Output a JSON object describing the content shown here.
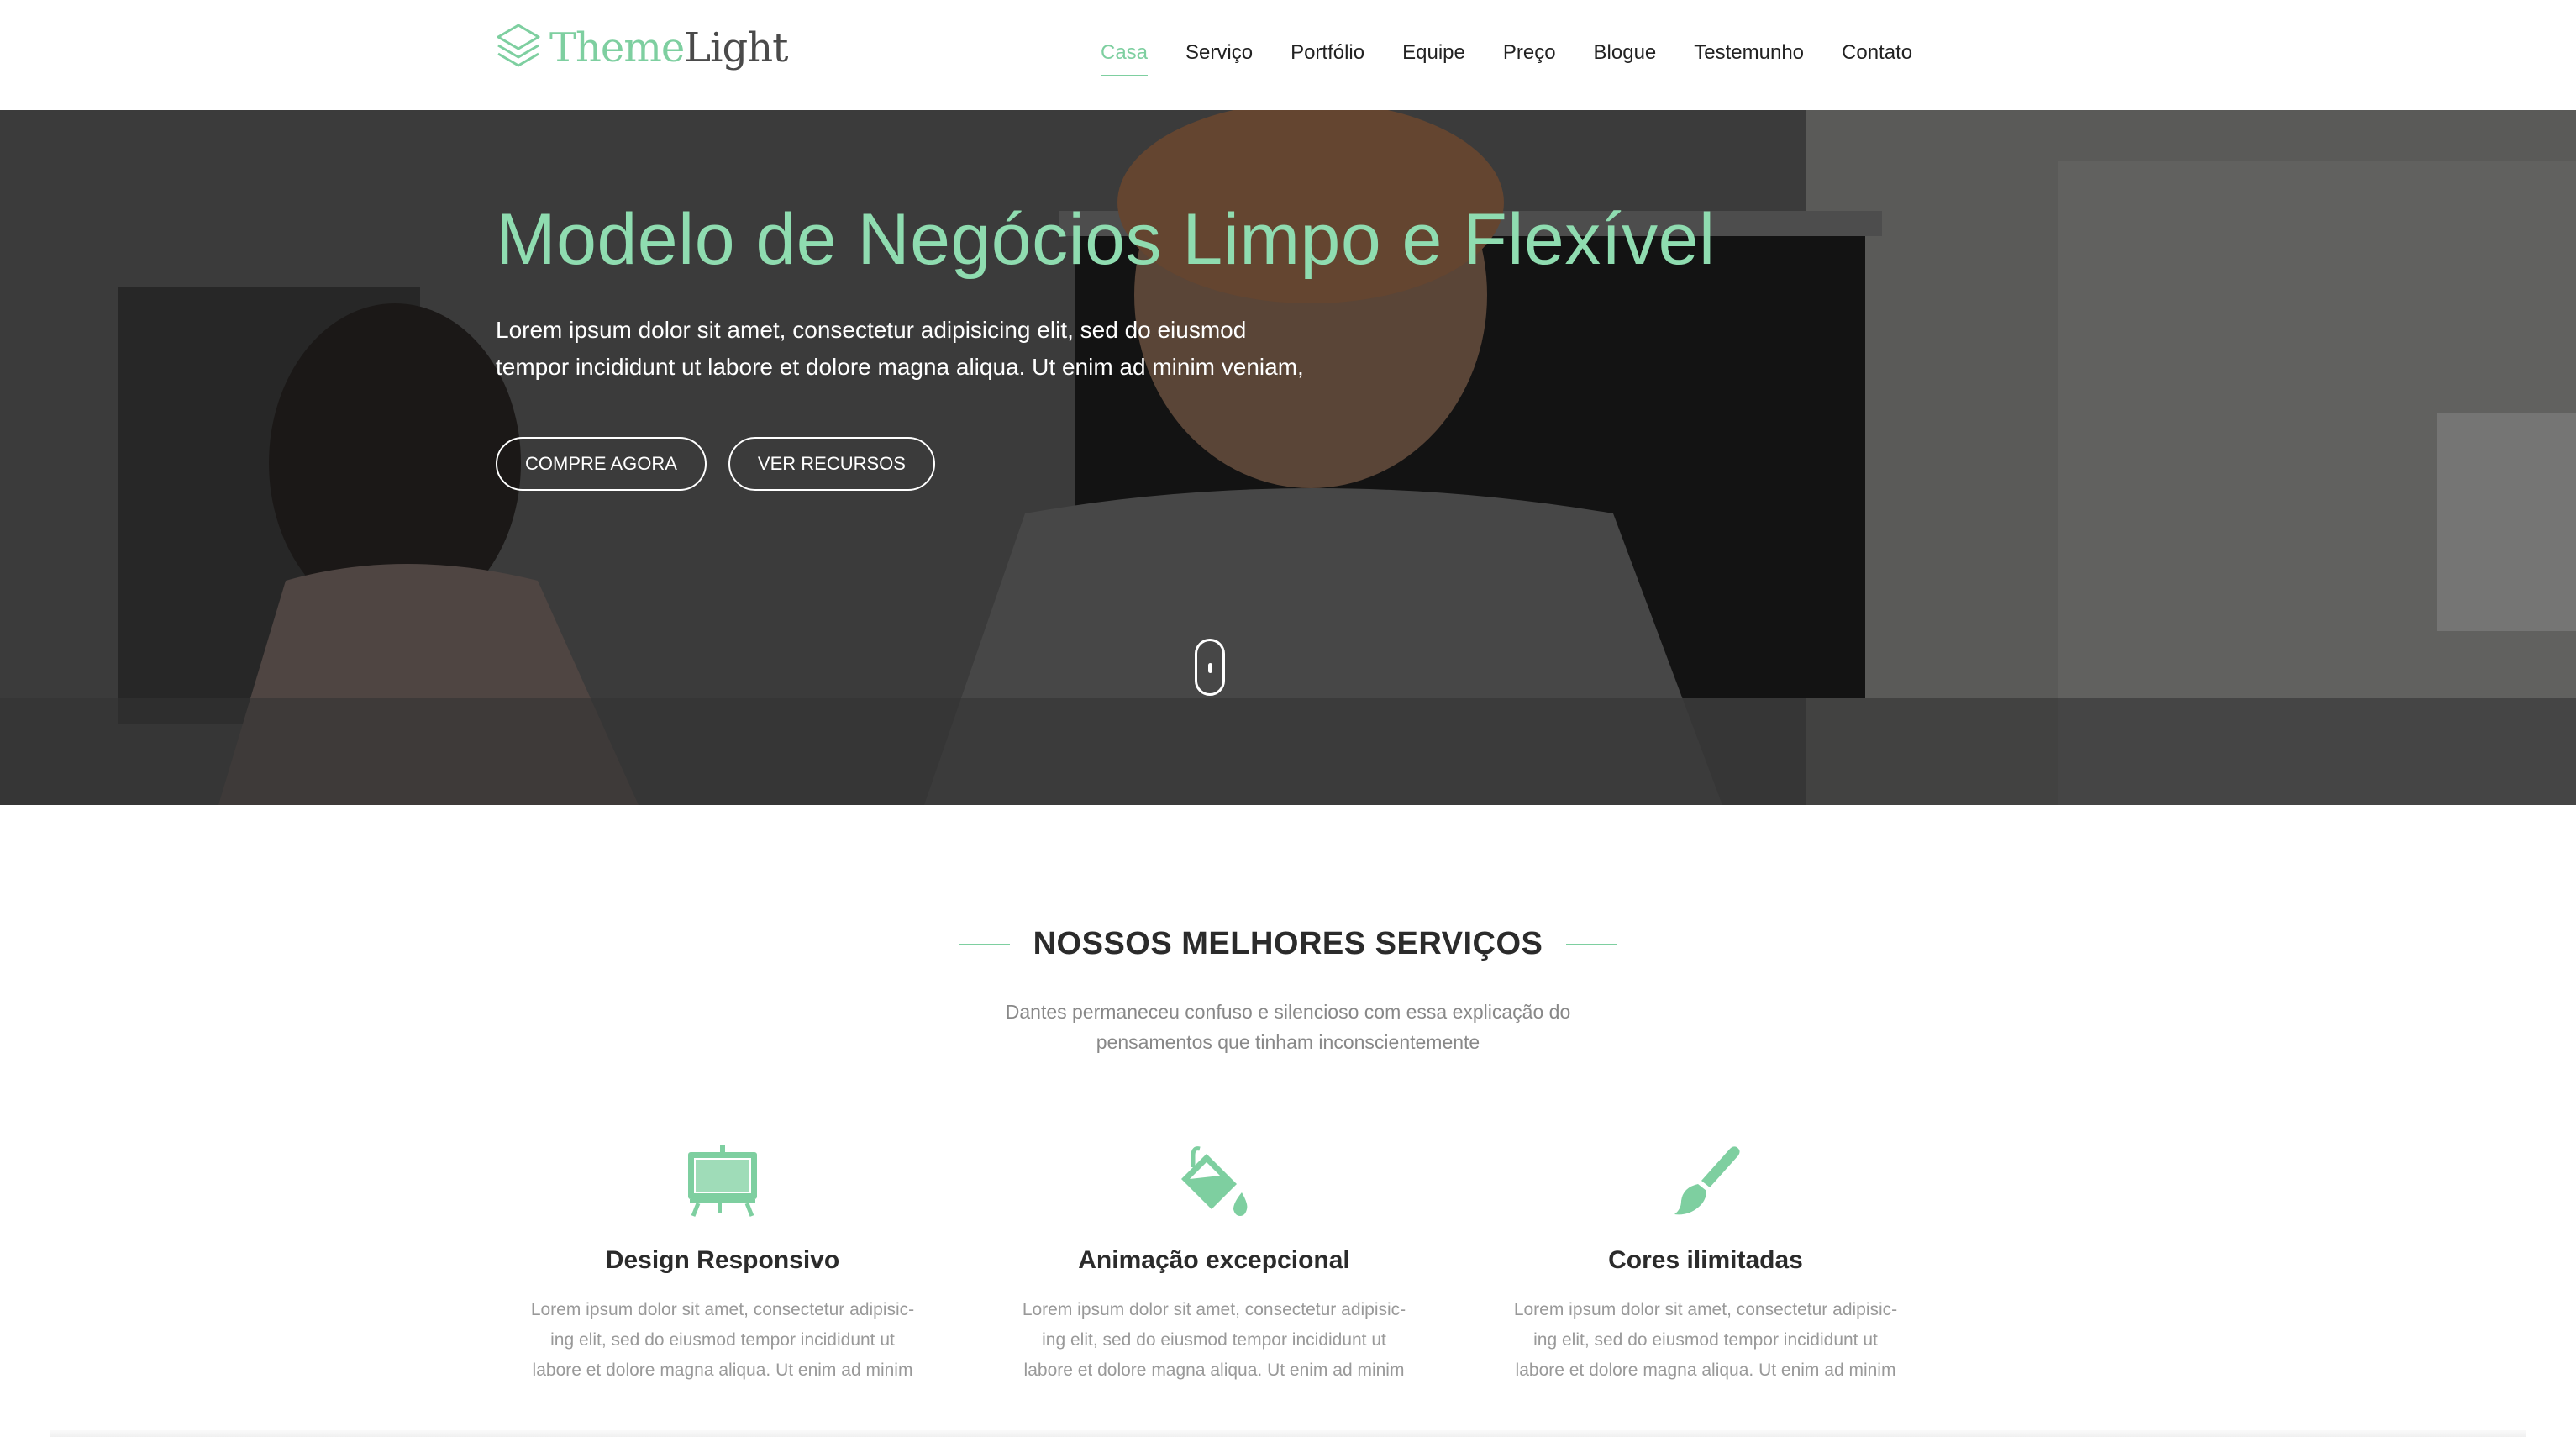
{
  "brand": {
    "theme": "Theme",
    "light": "Light",
    "accent": "#7ecfa0"
  },
  "nav": {
    "items": [
      {
        "label": "Casa",
        "active": true
      },
      {
        "label": "Serviço"
      },
      {
        "label": "Portfólio"
      },
      {
        "label": "Equipe"
      },
      {
        "label": "Preço"
      },
      {
        "label": "Blogue"
      },
      {
        "label": "Testemunho"
      },
      {
        "label": "Contato"
      }
    ]
  },
  "hero": {
    "title": "Modelo de Negócios Limpo e Flexível",
    "text_line1": "Lorem ipsum dolor sit amet, consectetur adipisicing elit, sed do eiusmod",
    "text_line2": "tempor incididunt ut labore et dolore magna aliqua. Ut enim ad minim veniam,",
    "btn_buy": "COMPRE AGORA",
    "btn_features": "VER RECURSOS"
  },
  "services": {
    "title": "NOSSOS MELHORES SERVIÇOS",
    "subtitle_line1": "Dantes permaneceu confuso e silencioso com essa explicação do",
    "subtitle_line2": "pensamentos que tinham inconscientemente",
    "items": [
      {
        "icon": "presentation-board-icon",
        "title": "Design Responsivo",
        "text1": "Lorem ipsum dolor sit amet, consectetur adipisic-",
        "text2": "ing elit, sed do eiusmod tempor incididunt ut",
        "text3": "labore et dolore magna aliqua. Ut enim ad minim"
      },
      {
        "icon": "paint-bucket-icon",
        "title": "Animação excepcional",
        "text1": "Lorem ipsum dolor sit amet, consectetur adipisic-",
        "text2": "ing elit, sed do eiusmod tempor incididunt ut",
        "text3": "labore et dolore magna aliqua. Ut enim ad minim"
      },
      {
        "icon": "paint-brush-icon",
        "title": "Cores ilimitadas",
        "text1": "Lorem ipsum dolor sit amet, consectetur adipisic-",
        "text2": "ing elit, sed do eiusmod tempor incididunt ut",
        "text3": "labore et dolore magna aliqua. Ut enim ad minim"
      }
    ]
  }
}
